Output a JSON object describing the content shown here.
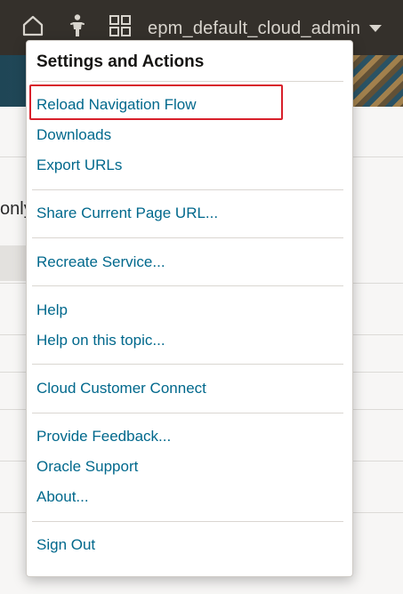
{
  "header": {
    "user_name": "epm_default_cloud_admin",
    "icons": [
      "home-icon",
      "accessibility-icon",
      "navigator-grid-icon",
      "chevron-down-icon"
    ]
  },
  "background": {
    "partial_text": "only"
  },
  "settings_menu": {
    "title": "Settings and Actions",
    "highlighted_item": "Reload Navigation Flow",
    "highlight_color": "#d8202b",
    "link_color": "#00688c",
    "groups": [
      [
        "Reload Navigation Flow",
        "Downloads",
        "Export URLs"
      ],
      [
        "Share Current Page URL..."
      ],
      [
        "Recreate Service..."
      ],
      [
        "Help",
        "Help on this topic..."
      ],
      [
        "Cloud Customer Connect"
      ],
      [
        "Provide Feedback...",
        "Oracle Support",
        "About..."
      ],
      [
        "Sign Out"
      ]
    ]
  }
}
